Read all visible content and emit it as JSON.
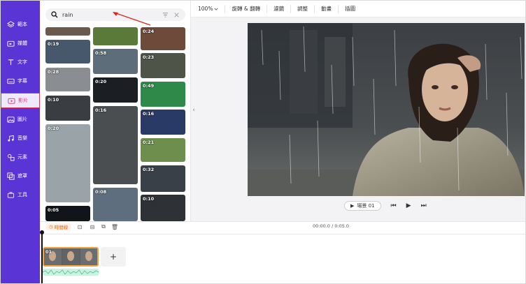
{
  "nav": {
    "items": [
      {
        "label": "範本",
        "icon": "layout-icon"
      },
      {
        "label": "媒體",
        "icon": "media-icon"
      },
      {
        "label": "文字",
        "icon": "text-icon"
      },
      {
        "label": "字幕",
        "icon": "subtitle-icon"
      },
      {
        "label": "影片",
        "icon": "video-icon"
      },
      {
        "label": "圖片",
        "icon": "image-icon"
      },
      {
        "label": "音樂",
        "icon": "music-icon"
      },
      {
        "label": "元素",
        "icon": "elements-icon"
      },
      {
        "label": "遮罩",
        "icon": "mask-icon"
      },
      {
        "label": "工具",
        "icon": "tools-icon"
      }
    ],
    "active_index": 4
  },
  "search": {
    "value": "rain"
  },
  "thumbnails": [
    {
      "duration": "",
      "bg": "#6a5a4e"
    },
    {
      "duration": "",
      "bg": "#5a7a3a"
    },
    {
      "duration": "0:24",
      "bg": "#6e4a3a"
    },
    {
      "duration": "0:19",
      "bg": "#47586c"
    },
    {
      "duration": "0:58",
      "bg": "#5e6d7a"
    },
    {
      "duration": "0:23",
      "bg": "#4e5448"
    },
    {
      "duration": "0:28",
      "bg": "#8a8e92"
    },
    {
      "duration": "0:20",
      "bg": "#1b1f24"
    },
    {
      "duration": "0:49",
      "bg": "#2f8a4a"
    },
    {
      "duration": "0:10",
      "bg": "#3a3e42"
    },
    {
      "duration": "0:16",
      "bg": "#4a4e50"
    },
    {
      "duration": "0:16",
      "bg": "#2a3a66"
    },
    {
      "duration": "0:20",
      "bg": "#9aa3a8"
    },
    {
      "duration": "0:21",
      "bg": "#6e8e4e"
    },
    {
      "duration": "0:32",
      "bg": "#3a4048"
    },
    {
      "duration": "0:08",
      "bg": "#5e6e7e"
    },
    {
      "duration": "0:10",
      "bg": "#2e3236"
    },
    {
      "duration": "0:05",
      "bg": "#111418"
    }
  ],
  "toolbar": {
    "zoom": "100%",
    "items": [
      "旋轉 & 翻轉",
      "濾鏡",
      "調整",
      "動畫",
      "插圖"
    ]
  },
  "controls": {
    "scene_label": "場景 01"
  },
  "timeline": {
    "current_time": "時間線",
    "timecode": "00:00.0 / 0:05.0",
    "clip_number": "01",
    "add_label": "+"
  },
  "colors": {
    "nav_bg": "#5b34d6",
    "active_border": "#e23a55",
    "clip_border": "#f2a444",
    "waveform": "#7de0b8"
  }
}
